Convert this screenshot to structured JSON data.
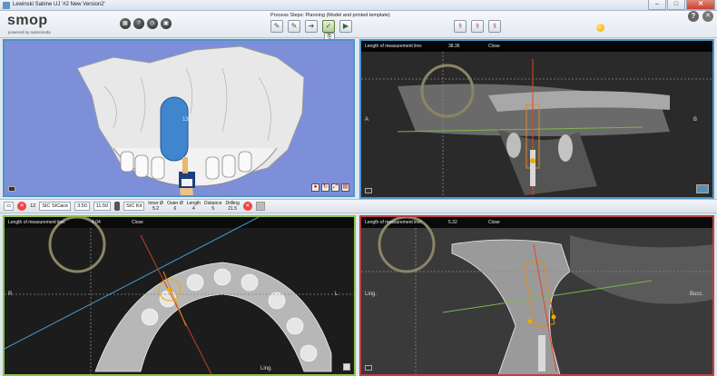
{
  "window": {
    "title": "Lewinski Sabine  UJ  '#2 New Version2'",
    "min": "–",
    "max": "□",
    "close": "✕"
  },
  "logo": {
    "text": "smop",
    "sub": "powered by swissmeda"
  },
  "toolbar_icons": [
    {
      "name": "grid-icon",
      "glyph": "▦"
    },
    {
      "name": "help-circle-icon",
      "glyph": "?"
    },
    {
      "name": "clock-icon",
      "glyph": "◷"
    },
    {
      "name": "camera-icon",
      "glyph": "▣"
    }
  ],
  "process": {
    "label": "Process Steps: Planning (Model and printed template)",
    "steps": [
      {
        "name": "step-1-button",
        "glyph": "✎"
      },
      {
        "name": "step-2-button",
        "glyph": "✎"
      },
      {
        "name": "step-3-button",
        "glyph": "➔"
      },
      {
        "name": "step-4-button",
        "glyph": "✓"
      },
      {
        "name": "step-5-button",
        "glyph": "▶"
      }
    ]
  },
  "tooth_buttons": [
    {
      "name": "tooth-tool-1-button",
      "glyph": "⚕"
    },
    {
      "name": "tooth-tool-2-button",
      "glyph": "⚕"
    },
    {
      "name": "tooth-tool-3-button",
      "glyph": "⚕"
    }
  ],
  "colors": {
    "status_dot": "#f2a600",
    "panel_blue": "#4a96c8",
    "panel_green": "#8bc34a",
    "panel_red": "#c04040"
  },
  "view_3d": {
    "implant_label": "13"
  },
  "axial_view": {
    "measure_label": "Length of measurement line:",
    "measure_value": "38.36",
    "close": "Close",
    "left": "A",
    "right": "B"
  },
  "implant_bar": {
    "count": "12",
    "system": "SIC SICace",
    "diameter": "3.50",
    "length": "11.50",
    "kit": "SIC Kit",
    "params": [
      {
        "label": "Inner Ø",
        "value": "5.2"
      },
      {
        "label": "Outer Ø",
        "value": "6"
      },
      {
        "label": "Length",
        "value": "4"
      },
      {
        "label": "Distance",
        "value": "5"
      },
      {
        "label": "Drilling",
        "value": "21.5"
      }
    ]
  },
  "pano_view": {
    "measure_label": "Length of measurement line:",
    "measure_value": "4.04",
    "close": "Close",
    "left": "R",
    "right": "L",
    "bottom": "Ling."
  },
  "coronal_view": {
    "measure_label": "Length of measurement line:",
    "measure_value": "5.32",
    "close": "Close",
    "left": "Ling.",
    "right": "Bucc."
  }
}
